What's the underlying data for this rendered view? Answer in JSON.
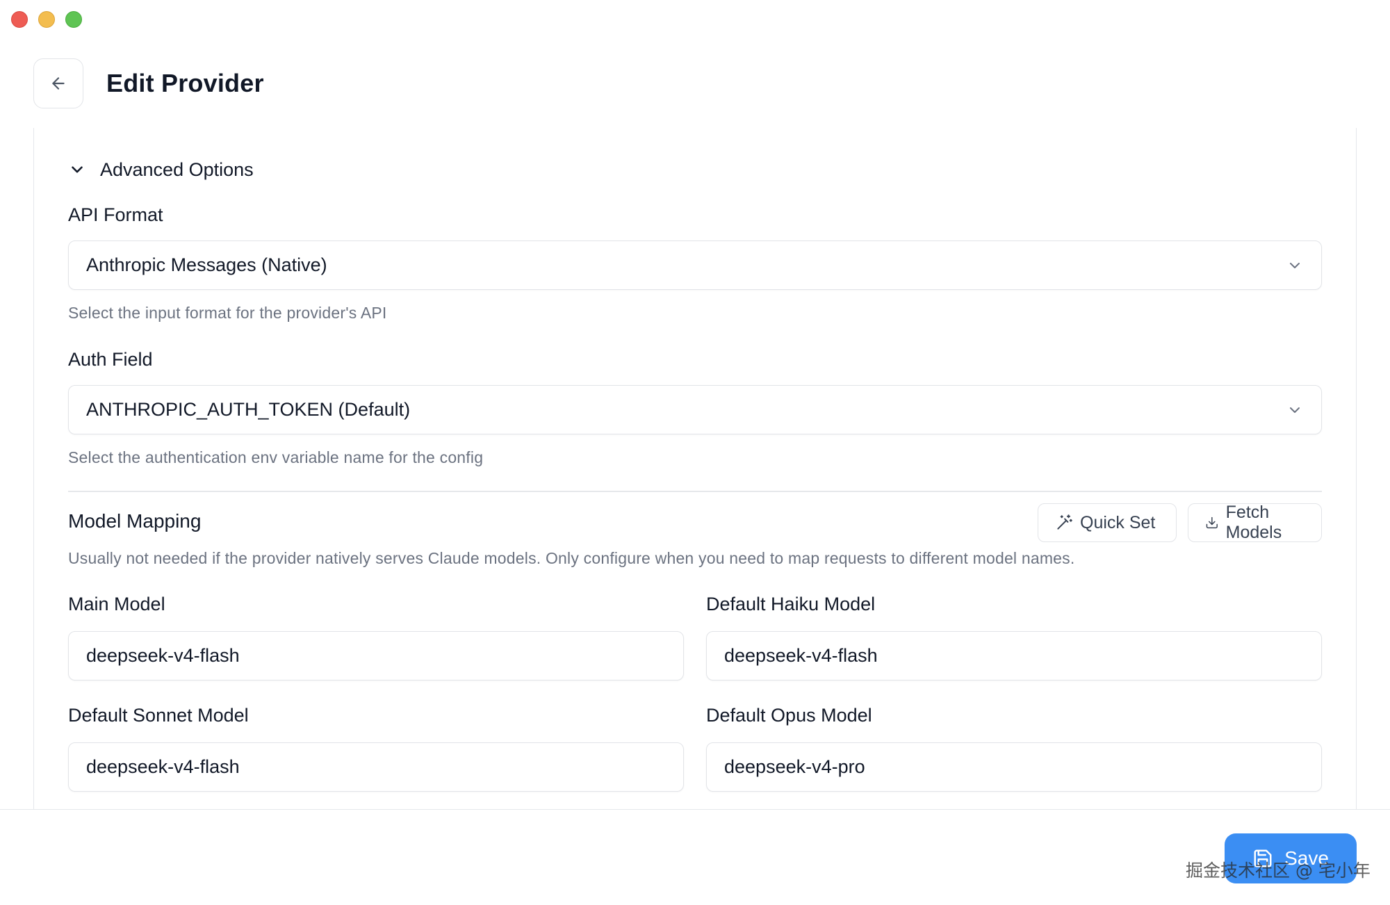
{
  "window": {
    "title": "Edit Provider"
  },
  "header": {
    "back_icon": "arrow-left-icon",
    "title": "Edit Provider"
  },
  "advanced": {
    "toggle_label": "Advanced Options",
    "toggle_icon": "chevron-down-icon"
  },
  "api_format": {
    "label": "API Format",
    "value": "Anthropic Messages (Native)",
    "hint": "Select the input format for the provider's API"
  },
  "auth_field": {
    "label": "Auth Field",
    "value": "ANTHROPIC_AUTH_TOKEN (Default)",
    "hint": "Select the authentication env variable name for the config"
  },
  "model_mapping": {
    "title": "Model Mapping",
    "description": "Usually not needed if the provider natively serves Claude models. Only configure when you need to map requests to different model names.",
    "quick_set_label": "Quick Set",
    "fetch_models_label": "Fetch Models",
    "fields": {
      "main": {
        "label": "Main Model",
        "value": "deepseek-v4-flash"
      },
      "haiku": {
        "label": "Default Haiku Model",
        "value": "deepseek-v4-flash"
      },
      "sonnet": {
        "label": "Default Sonnet Model",
        "value": "deepseek-v4-flash"
      },
      "opus": {
        "label": "Default Opus Model",
        "value": "deepseek-v4-pro"
      }
    }
  },
  "footer": {
    "save_label": "Save",
    "watermark": "掘金技术社区 @ 宅小年"
  },
  "colors": {
    "accent": "#3b8ef3",
    "border": "#e2e4e8",
    "hint_text": "#6b7280"
  }
}
